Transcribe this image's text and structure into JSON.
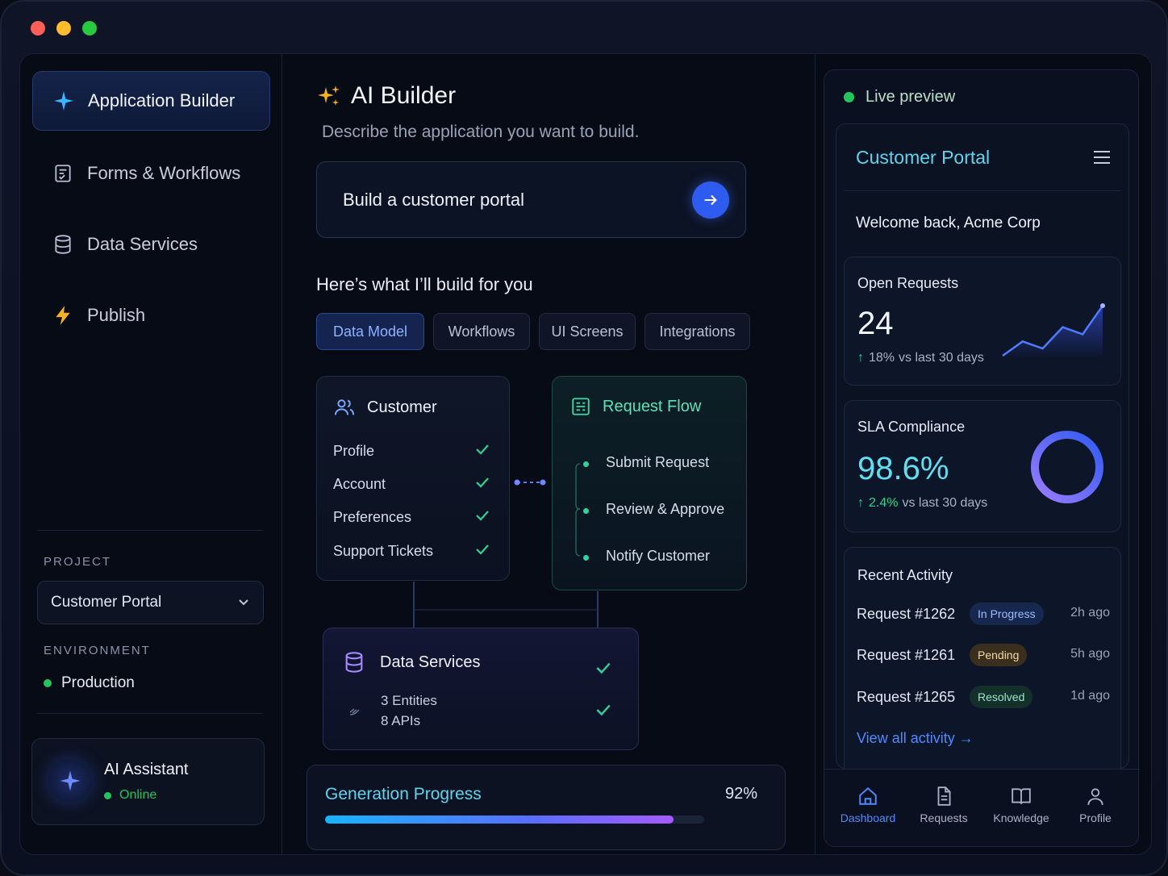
{
  "sidebar": {
    "items": [
      {
        "label": "Application Builder",
        "icon": "sparkle-icon",
        "active": true
      },
      {
        "label": "Forms & Workflows",
        "icon": "form-icon"
      },
      {
        "label": "Data Services",
        "icon": "database-icon"
      },
      {
        "label": "Publish",
        "icon": "lightning-icon"
      }
    ],
    "project_label": "PROJECT",
    "project_value": "Customer Portal",
    "environment_label": "ENVIRONMENT",
    "environment_value": "Production",
    "assistant_name": "AI Assistant",
    "assistant_status": "Online"
  },
  "main": {
    "title": "AI Builder",
    "subtitle": "Describe the application you want to build.",
    "prompt_value": "Build a customer portal",
    "section_heading": "Here’s what I’ll build for you",
    "tabs": [
      {
        "label": "Data Model",
        "active": true
      },
      {
        "label": "Workflows"
      },
      {
        "label": "UI Screens"
      },
      {
        "label": "Integrations"
      }
    ],
    "customer_card": {
      "title": "Customer",
      "rows": [
        "Profile",
        "Account",
        "Preferences",
        "Support Tickets"
      ]
    },
    "flow_card": {
      "title": "Request Flow",
      "steps": [
        "Submit Request",
        "Review & Approve",
        "Notify Customer"
      ]
    },
    "data_services_card": {
      "title": "Data Services",
      "entities": "3 Entities",
      "apis": "8 APIs"
    },
    "progress": {
      "label": "Generation Progress",
      "value_text": "92%",
      "value": 0.92
    }
  },
  "preview": {
    "live_label": "Live preview",
    "portal_title": "Customer Portal",
    "welcome": "Welcome back, Acme Corp",
    "open_requests": {
      "label": "Open Requests",
      "value": "24",
      "delta_pct": "18%",
      "delta_text": "vs last 30 days",
      "sparkline": [
        2,
        4,
        3,
        6,
        5,
        9
      ]
    },
    "sla": {
      "label": "SLA Compliance",
      "value": "98.6%",
      "delta_pct": "2.4%",
      "delta_text": "vs last 30 days",
      "fraction": 0.986
    },
    "recent_activity": {
      "title": "Recent Activity",
      "rows": [
        {
          "request": "Request #1262",
          "status": "In Progress",
          "time": "2h ago"
        },
        {
          "request": "Request #1261",
          "status": "Pending",
          "time": "5h ago"
        },
        {
          "request": "Request #1265",
          "status": "Resolved",
          "time": "1d ago"
        }
      ],
      "view_all": "View all activity →"
    },
    "bottom_nav": [
      {
        "label": "Dashboard",
        "icon": "home-icon",
        "active": true
      },
      {
        "label": "Requests",
        "icon": "document-icon"
      },
      {
        "label": "Knowledge",
        "icon": "book-icon"
      },
      {
        "label": "Profile",
        "icon": "user-icon"
      }
    ]
  },
  "colors": {
    "accent": "#2f5cf0",
    "cyan": "#5fd4ef",
    "green": "#22c55e",
    "background": "#070b15"
  }
}
